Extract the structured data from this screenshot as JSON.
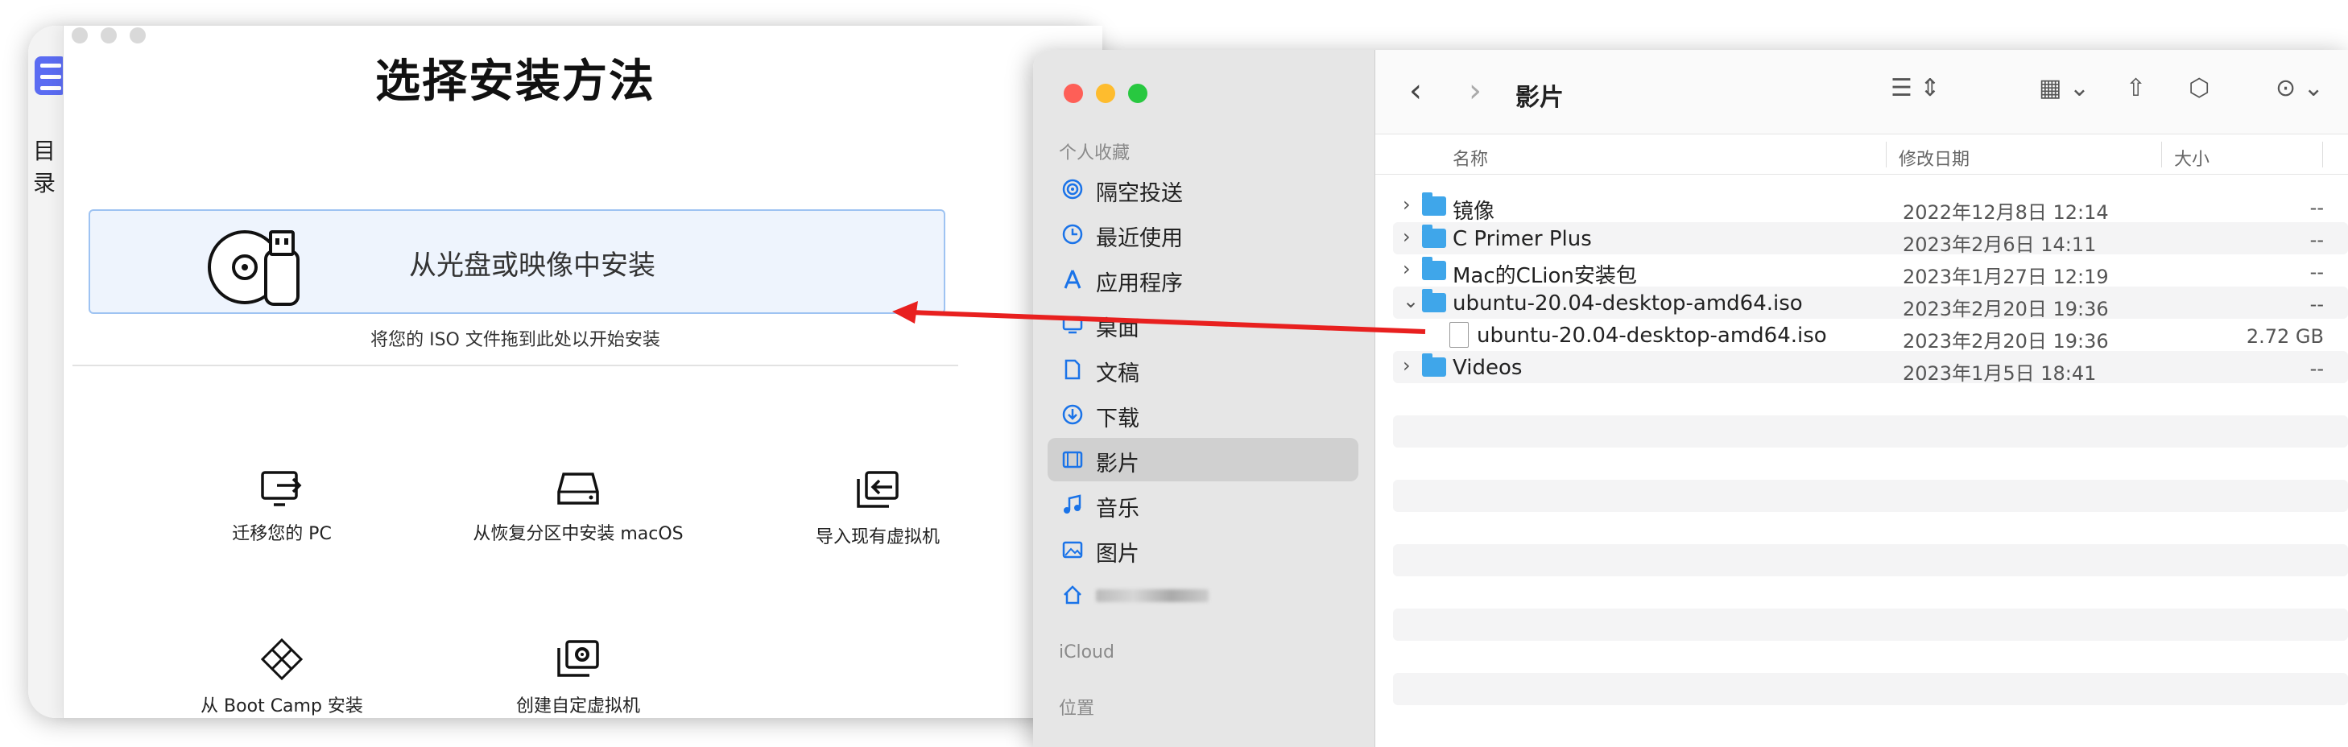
{
  "back_app": {
    "sidebar_label": "目录"
  },
  "dialog": {
    "title": "选择安装方法",
    "disc_option": {
      "label": "从光盘或映像中安装",
      "hint": "将您的 ISO 文件拖到此处以开始安装"
    },
    "options": [
      {
        "label": "迁移您的 PC",
        "icon": "migrate-pc-icon"
      },
      {
        "label": "从恢复分区中安装 macOS",
        "icon": "hard-drive-icon"
      },
      {
        "label": "导入现有虚拟机",
        "icon": "import-vm-icon"
      },
      {
        "label": "从 Boot Camp 安装",
        "icon": "bootcamp-icon"
      },
      {
        "label": "创建自定虚拟机",
        "icon": "custom-vm-icon"
      }
    ]
  },
  "finder": {
    "title": "影片",
    "sidebar": {
      "favorites_heading": "个人收藏",
      "items": [
        {
          "label": "隔空投送",
          "icon": "airdrop-icon"
        },
        {
          "label": "最近使用",
          "icon": "clock-icon"
        },
        {
          "label": "应用程序",
          "icon": "applications-icon"
        },
        {
          "label": "桌面",
          "icon": "desktop-icon"
        },
        {
          "label": "文稿",
          "icon": "document-icon"
        },
        {
          "label": "下载",
          "icon": "download-icon"
        },
        {
          "label": "影片",
          "icon": "film-icon",
          "selected": true
        },
        {
          "label": "音乐",
          "icon": "music-icon"
        },
        {
          "label": "图片",
          "icon": "photo-icon"
        }
      ],
      "icloud_heading": "iCloud",
      "locations_heading": "位置"
    },
    "columns": {
      "name": "名称",
      "modified": "修改日期",
      "size": "大小"
    },
    "rows": [
      {
        "name": "镜像",
        "date": "2022年12月8日 12:14",
        "size": "--",
        "type": "folder",
        "expanded": false
      },
      {
        "name": "C Primer Plus",
        "date": "2023年2月6日 14:11",
        "size": "--",
        "type": "folder",
        "expanded": false
      },
      {
        "name": "Mac的CLion安装包",
        "date": "2023年1月27日 12:19",
        "size": "--",
        "type": "folder",
        "expanded": false
      },
      {
        "name": "ubuntu-20.04-desktop-amd64.iso",
        "date": "2023年2月20日 19:36",
        "size": "--",
        "type": "folder",
        "expanded": true
      },
      {
        "name": "ubuntu-20.04-desktop-amd64.iso",
        "date": "2023年2月20日 19:36",
        "size": "2.72 GB",
        "type": "file",
        "expanded": false
      },
      {
        "name": "Videos",
        "date": "2023年1月5日 18:41",
        "size": "--",
        "type": "folder",
        "expanded": false
      }
    ]
  },
  "colors": {
    "accent_blue": "#1a73e8",
    "folder_blue": "#3fa6ea",
    "arrow_red": "#e8201f"
  }
}
